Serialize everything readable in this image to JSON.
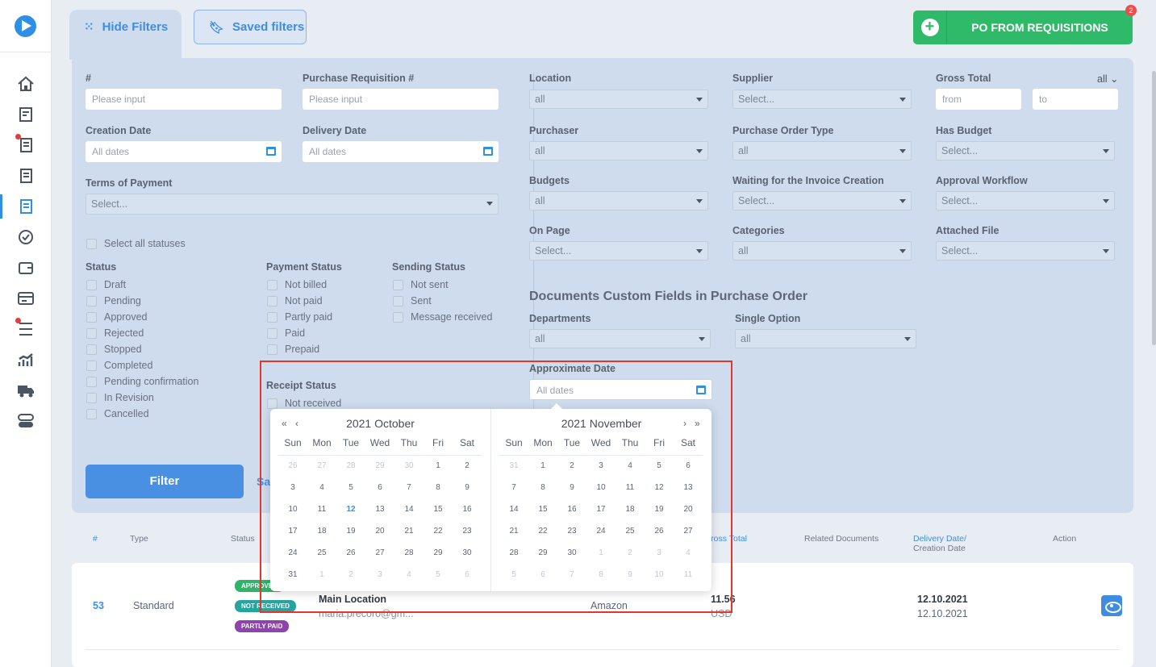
{
  "tabs": {
    "hide": "Hide Filters",
    "saved": "Saved filters"
  },
  "po_button": {
    "label": "PO FROM REQUISITIONS",
    "badge": "2"
  },
  "filters": {
    "number": {
      "label": "#",
      "placeholder": "Please input"
    },
    "pr_number": {
      "label": "Purchase Requisition #",
      "placeholder": "Please input"
    },
    "creation_date": {
      "label": "Creation Date",
      "value": "All dates"
    },
    "delivery_date": {
      "label": "Delivery Date",
      "value": "All dates"
    },
    "terms": {
      "label": "Terms of Payment",
      "value": "Select..."
    },
    "location": {
      "label": "Location",
      "value": "all"
    },
    "supplier": {
      "label": "Supplier",
      "value": "Select..."
    },
    "gross_total": {
      "label": "Gross Total",
      "mode": "all",
      "from": "from",
      "to": "to"
    },
    "purchaser": {
      "label": "Purchaser",
      "value": "all"
    },
    "po_type": {
      "label": "Purchase Order Type",
      "value": "all"
    },
    "has_budget": {
      "label": "Has Budget",
      "value": "Select..."
    },
    "budgets": {
      "label": "Budgets",
      "value": "all"
    },
    "waiting_invoice": {
      "label": "Waiting for the Invoice Creation",
      "value": "Select..."
    },
    "approval_workflow": {
      "label": "Approval Workflow",
      "value": "Select..."
    },
    "on_page": {
      "label": "On Page",
      "value": "Select..."
    },
    "categories": {
      "label": "Categories",
      "value": "all"
    },
    "attached_file": {
      "label": "Attached File",
      "value": "Select..."
    },
    "custom_title": "Documents Custom Fields in Purchase Order",
    "departments": {
      "label": "Departments",
      "value": "all"
    },
    "single_option": {
      "label": "Single Option",
      "value": "all"
    },
    "approx_date": {
      "label": "Approximate Date",
      "value": "All dates"
    },
    "select_all": "Select all statuses",
    "status": {
      "label": "Status",
      "items": [
        "Draft",
        "Pending",
        "Approved",
        "Rejected",
        "Stopped",
        "Completed",
        "Pending confirmation",
        "In Revision",
        "Cancelled"
      ]
    },
    "payment": {
      "label": "Payment Status",
      "items": [
        "Not billed",
        "Not paid",
        "Partly paid",
        "Paid",
        "Prepaid"
      ]
    },
    "sending": {
      "label": "Sending Status",
      "items": [
        "Not sent",
        "Sent",
        "Message received"
      ]
    },
    "receipt": {
      "label": "Receipt Status",
      "items": [
        "Not received"
      ]
    },
    "filter_btn": "Filter",
    "save_link": "Sa"
  },
  "table": {
    "headers": {
      "num": "#",
      "type": "Type",
      "status": "Status",
      "gross": "Gross Total",
      "related": "Related Documents",
      "delivery1": "Delivery Date/",
      "delivery2": "Creation Date",
      "action": "Action"
    },
    "row": {
      "num": "53",
      "type": "Standard",
      "pills": [
        "APPROVED",
        "NOT RECEIVED",
        "PARTLY PAID"
      ],
      "location": "Main Location",
      "email": "maria.precoro@gm...",
      "supplier": "Amazon",
      "total": "11.56",
      "currency": "USD",
      "delivery": "12.10.2021",
      "created": "12.10.2021"
    }
  },
  "datepicker": {
    "dow": [
      "Sun",
      "Mon",
      "Tue",
      "Wed",
      "Thu",
      "Fri",
      "Sat"
    ],
    "left": {
      "title": "2021 October",
      "weeks": [
        [
          "26",
          "27",
          "28",
          "29",
          "30",
          "1",
          "2"
        ],
        [
          "3",
          "4",
          "5",
          "6",
          "7",
          "8",
          "9"
        ],
        [
          "10",
          "11",
          "12",
          "13",
          "14",
          "15",
          "16"
        ],
        [
          "17",
          "18",
          "19",
          "20",
          "21",
          "22",
          "23"
        ],
        [
          "24",
          "25",
          "26",
          "27",
          "28",
          "29",
          "30"
        ],
        [
          "31",
          "1",
          "2",
          "3",
          "4",
          "5",
          "6"
        ]
      ]
    },
    "right": {
      "title": "2021 November",
      "weeks": [
        [
          "31",
          "1",
          "2",
          "3",
          "4",
          "5",
          "6"
        ],
        [
          "7",
          "8",
          "9",
          "10",
          "11",
          "12",
          "13"
        ],
        [
          "14",
          "15",
          "16",
          "17",
          "18",
          "19",
          "20"
        ],
        [
          "21",
          "22",
          "23",
          "24",
          "25",
          "26",
          "27"
        ],
        [
          "28",
          "29",
          "30",
          "1",
          "2",
          "3",
          "4"
        ],
        [
          "5",
          "6",
          "7",
          "8",
          "9",
          "10",
          "11"
        ]
      ]
    },
    "nav": {
      "prev_year": "«",
      "prev_month": "‹",
      "next_month": "›",
      "next_year": "»"
    }
  },
  "colors": {
    "accent": "#3f8de0",
    "green": "#2fba6a",
    "approved": "#2fb46a",
    "not_received": "#27a3a0",
    "partly_paid": "#8e44ad",
    "highlight": "#e0392b"
  }
}
